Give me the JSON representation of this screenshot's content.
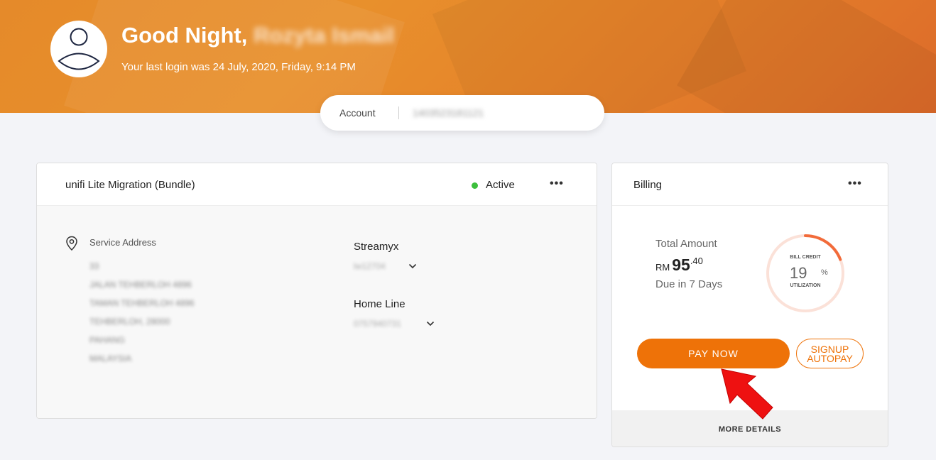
{
  "header": {
    "greeting": "Good Night,",
    "user_name": "Rozyta Ismail",
    "last_login": "Your last login was 24 July, 2020, Friday, 9:14 PM"
  },
  "account": {
    "label": "Account",
    "number": "1403523181121"
  },
  "service_card": {
    "title": "unifi Lite Migration (Bundle)",
    "status": "Active",
    "address_label": "Service Address",
    "address_lines": [
      "33",
      "JALAN TEHBERLOH 4896",
      "TAMAN TEHBERLOH 4896",
      "TEHBERLOH, 28000",
      "PAHANG",
      "MALAYSIA"
    ],
    "services": [
      {
        "name": "Streamyx",
        "value": "lw12704"
      },
      {
        "name": "Home Line",
        "value": "0757940731"
      }
    ]
  },
  "billing_card": {
    "title": "Billing",
    "total_label": "Total Amount",
    "currency": "RM",
    "amount_whole": "95",
    "amount_decimal": ".40",
    "due": "Due in 7 Days",
    "credit_top": "BILL CREDIT",
    "credit_percent": "19",
    "percent_sign": "%",
    "credit_bottom": "UTILIZATION",
    "credit_fraction": 0.19,
    "pay_label": "PAY NOW",
    "autopay_line1": "SIGNUP",
    "autopay_line2": "AUTOPAY",
    "more_details": "MORE DETAILS"
  },
  "colors": {
    "brand_orange": "#ee7208",
    "active_green": "#3cbf3c",
    "ring_track": "#fbe1d8",
    "ring_fill": "#f26b3a",
    "arrow_red": "#ee1111"
  },
  "icons": {
    "avatar": "user-avatar-icon",
    "location": "map-pin-icon",
    "more": "ellipsis-icon",
    "dropdown": "chevron-down-icon",
    "pointer": "red-arrow-icon"
  }
}
